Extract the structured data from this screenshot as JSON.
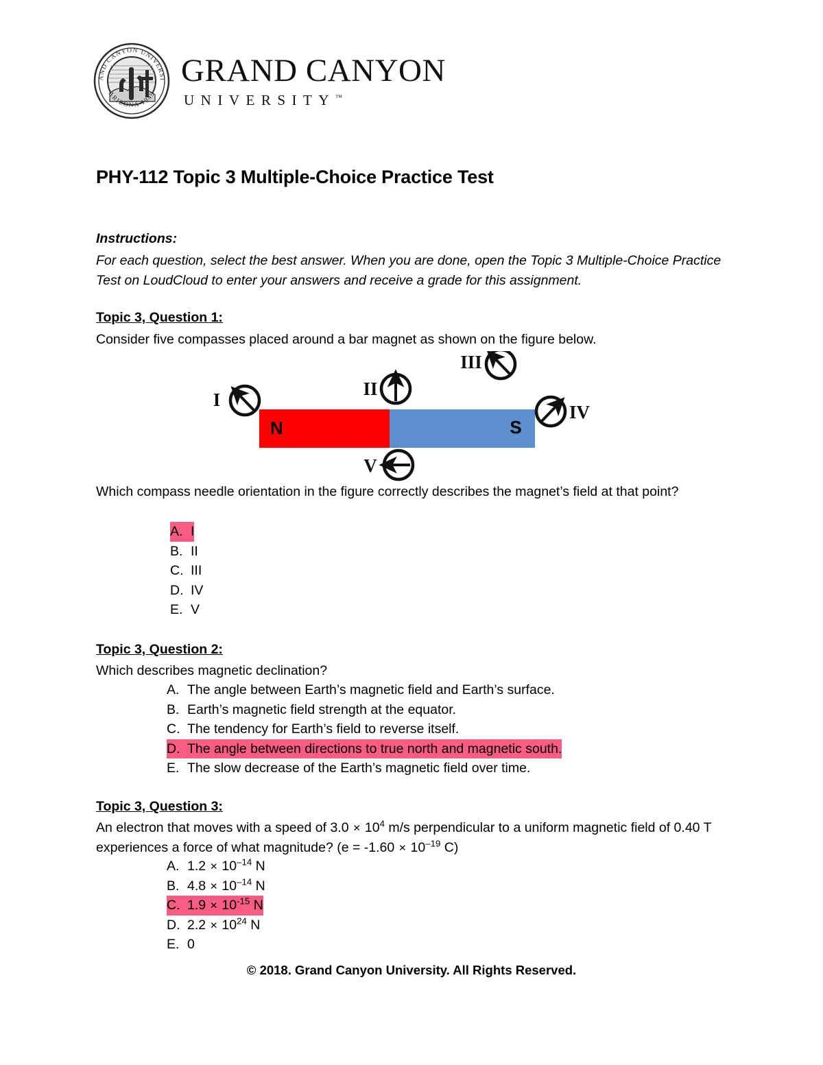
{
  "header": {
    "seal_text_top": "GRAND CANYON UNIVERSITY",
    "seal_text_bottom": "ARIZONA 1949",
    "wordmark_line1": "GRAND CANYON",
    "wordmark_line2": "UNIVERSITY",
    "trademark": "™"
  },
  "document": {
    "title": "PHY-112 Topic 3 Multiple-Choice Practice Test",
    "instructions_label": "Instructions:",
    "instructions_body": "For each question, select the best answer. When you are done, open the Topic 3 Multiple-Choice Practice Test on LoudCloud to enter your answers and receive a grade for this assignment.",
    "footer": "© 2018. Grand Canyon University. All Rights Reserved."
  },
  "colors": {
    "highlight": "#FA5C82",
    "magnet_north": "#FF0000",
    "magnet_south": "#5B8FD0"
  },
  "questions": [
    {
      "heading": "Topic 3, Question 1:",
      "intro": "Consider five compasses placed around a bar magnet as shown on the figure below.",
      "prompt": "Which compass needle orientation in the figure correctly describes the magnet’s field at that point?",
      "options": [
        {
          "letter": "A.",
          "text": "I",
          "highlighted": true
        },
        {
          "letter": "B.",
          "text": "II",
          "highlighted": false
        },
        {
          "letter": "C.",
          "text": "III",
          "highlighted": false
        },
        {
          "letter": "D.",
          "text": "IV",
          "highlighted": false
        },
        {
          "letter": "E.",
          "text": "V",
          "highlighted": false
        }
      ]
    },
    {
      "heading": "Topic 3, Question 2:",
      "prompt": "Which describes magnetic declination?",
      "options": [
        {
          "letter": "A.",
          "text": "The angle between Earth’s magnetic field and Earth’s surface.",
          "highlighted": false
        },
        {
          "letter": "B.",
          "text": "Earth’s magnetic field strength at the equator.",
          "highlighted": false
        },
        {
          "letter": "C.",
          "text": "The tendency for Earth’s field to reverse itself.",
          "highlighted": false
        },
        {
          "letter": "D.",
          "text": "The angle between directions to true north and magnetic south.",
          "highlighted": true
        },
        {
          "letter": "E.",
          "text": "The slow decrease of the Earth’s magnetic field over time.",
          "highlighted": false
        }
      ]
    },
    {
      "heading": "Topic 3, Question 3:",
      "prompt_part1": " An electron that moves with a speed of 3.0 ",
      "prompt_mult1": "×",
      "prompt_base1": " 10",
      "prompt_exp1": "4",
      "prompt_part2": " m/s perpendicular to a uniform magnetic field of 0.40 T experiences a force of what magnitude? (e = -1.60 ",
      "prompt_mult2": "×",
      "prompt_base2": " 10",
      "prompt_exp2": "–19",
      "prompt_part3": " C)",
      "options": [
        {
          "letter": "A.",
          "mantissa": "1.2 ",
          "mult": "×",
          "base": " 10",
          "exp": "–14",
          "unit": " N",
          "highlighted": false
        },
        {
          "letter": "B.",
          "mantissa": "4.8 ",
          "mult": "×",
          "base": " 10",
          "exp": "–14",
          "unit": " N",
          "highlighted": false
        },
        {
          "letter": "C.",
          "mantissa": "1.9 ",
          "mult": "×",
          "base": " 10",
          "exp": "-15",
          "unit": " N",
          "highlighted": true
        },
        {
          "letter": "D.",
          "mantissa": "2.2 ",
          "mult": "×",
          "base": " 10",
          "exp": "24",
          "unit": " N",
          "highlighted": false
        },
        {
          "letter": "E.",
          "mantissa": "0",
          "mult": "",
          "base": "",
          "exp": "",
          "unit": "",
          "highlighted": false
        }
      ]
    }
  ],
  "figure": {
    "north_label": "N",
    "south_label": "S",
    "compasses": [
      {
        "label": "I",
        "direction": "northwest",
        "angle_deg": 315
      },
      {
        "label": "II",
        "direction": "north",
        "angle_deg": 0
      },
      {
        "label": "III",
        "direction": "northwest",
        "angle_deg": 315
      },
      {
        "label": "IV",
        "direction": "northeast",
        "angle_deg": 45
      },
      {
        "label": "V",
        "direction": "west",
        "angle_deg": 270
      }
    ]
  }
}
